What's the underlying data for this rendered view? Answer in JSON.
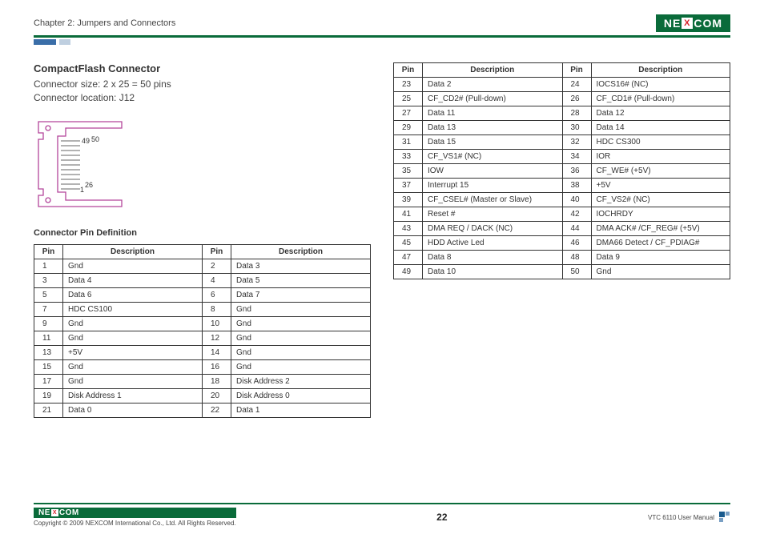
{
  "header": {
    "chapter": "Chapter 2: Jumpers and Connectors",
    "logo_text_a": "NE",
    "logo_text_x": "X",
    "logo_text_b": "COM"
  },
  "section": {
    "title": "CompactFlash Connector",
    "size_line": "Connector size: 2 x 25 = 50 pins",
    "loc_line": "Connector location: J12",
    "subhead": "Connector Pin Definition"
  },
  "diagram": {
    "label_49": "49",
    "label_50": "50",
    "label_1": "1",
    "label_26": "26"
  },
  "table_headers": {
    "pin": "Pin",
    "desc": "Description"
  },
  "left_rows": [
    {
      "p1": "1",
      "d1": "Gnd",
      "p2": "2",
      "d2": "Data 3"
    },
    {
      "p1": "3",
      "d1": "Data 4",
      "p2": "4",
      "d2": "Data 5"
    },
    {
      "p1": "5",
      "d1": "Data 6",
      "p2": "6",
      "d2": "Data 7"
    },
    {
      "p1": "7",
      "d1": "HDC CS100",
      "p2": "8",
      "d2": "Gnd"
    },
    {
      "p1": "9",
      "d1": "Gnd",
      "p2": "10",
      "d2": "Gnd"
    },
    {
      "p1": "11",
      "d1": "Gnd",
      "p2": "12",
      "d2": "Gnd"
    },
    {
      "p1": "13",
      "d1": "+5V",
      "p2": "14",
      "d2": "Gnd"
    },
    {
      "p1": "15",
      "d1": "Gnd",
      "p2": "16",
      "d2": "Gnd"
    },
    {
      "p1": "17",
      "d1": "Gnd",
      "p2": "18",
      "d2": "Disk Address 2"
    },
    {
      "p1": "19",
      "d1": "Disk Address 1",
      "p2": "20",
      "d2": "Disk Address 0"
    },
    {
      "p1": "21",
      "d1": "Data 0",
      "p2": "22",
      "d2": "Data 1"
    }
  ],
  "right_rows": [
    {
      "p1": "23",
      "d1": "Data 2",
      "p2": "24",
      "d2": "IOCS16# (NC)"
    },
    {
      "p1": "25",
      "d1": "CF_CD2# (Pull-down)",
      "p2": "26",
      "d2": "CF_CD1# (Pull-down)"
    },
    {
      "p1": "27",
      "d1": "Data 11",
      "p2": "28",
      "d2": "Data 12"
    },
    {
      "p1": "29",
      "d1": "Data 13",
      "p2": "30",
      "d2": "Data 14"
    },
    {
      "p1": "31",
      "d1": "Data 15",
      "p2": "32",
      "d2": "HDC CS300"
    },
    {
      "p1": "33",
      "d1": "CF_VS1# (NC)",
      "p2": "34",
      "d2": "IOR"
    },
    {
      "p1": "35",
      "d1": "IOW",
      "p2": "36",
      "d2": "CF_WE# (+5V)"
    },
    {
      "p1": "37",
      "d1": "Interrupt 15",
      "p2": "38",
      "d2": "+5V"
    },
    {
      "p1": "39",
      "d1": "CF_CSEL# (Master or Slave)",
      "p2": "40",
      "d2": "CF_VS2# (NC)"
    },
    {
      "p1": "41",
      "d1": "Reset #",
      "p2": "42",
      "d2": "IOCHRDY"
    },
    {
      "p1": "43",
      "d1": "DMA REQ / DACK (NC)",
      "p2": "44",
      "d2": "DMA ACK# /CF_REG# (+5V)"
    },
    {
      "p1": "45",
      "d1": "HDD Active Led",
      "p2": "46",
      "d2": "DMA66 Detect / CF_PDIAG#"
    },
    {
      "p1": "47",
      "d1": "Data 8",
      "p2": "48",
      "d2": "Data 9"
    },
    {
      "p1": "49",
      "d1": "Data 10",
      "p2": "50",
      "d2": "Gnd"
    }
  ],
  "footer": {
    "copyright": "Copyright © 2009 NEXCOM International Co., Ltd. All Rights Reserved.",
    "page_num": "22",
    "manual": "VTC 6110 User Manual"
  }
}
